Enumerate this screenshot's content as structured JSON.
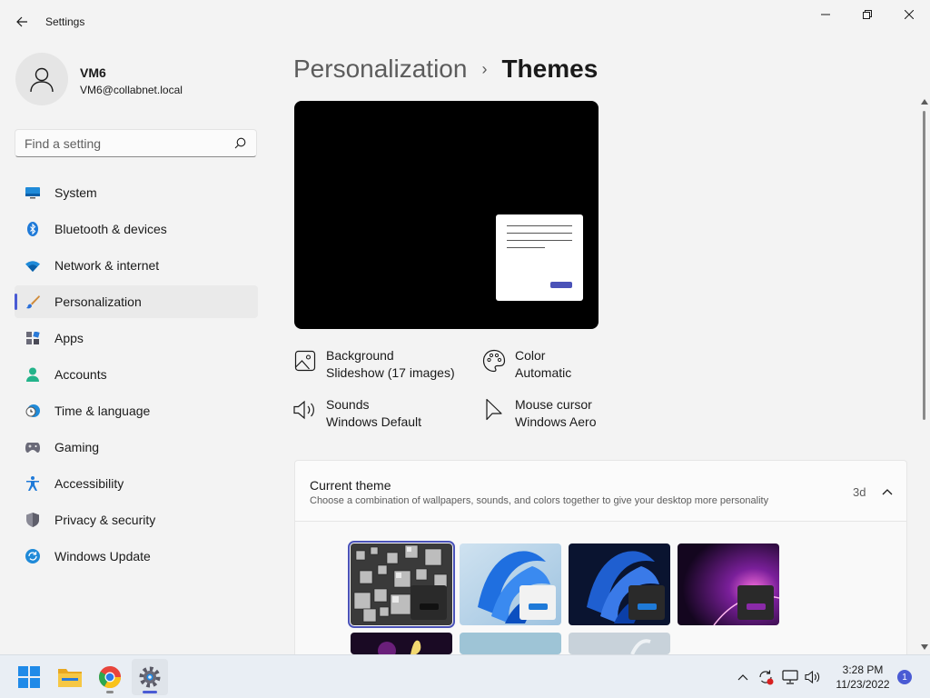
{
  "window": {
    "title": "Settings"
  },
  "profile": {
    "name": "VM6",
    "email": "VM6@collabnet.local"
  },
  "search": {
    "placeholder": "Find a setting"
  },
  "nav": {
    "items": [
      {
        "label": "System",
        "icon": "monitor-icon"
      },
      {
        "label": "Bluetooth & devices",
        "icon": "bluetooth-icon"
      },
      {
        "label": "Network & internet",
        "icon": "wifi-icon"
      },
      {
        "label": "Personalization",
        "icon": "brush-icon",
        "active": true
      },
      {
        "label": "Apps",
        "icon": "apps-icon"
      },
      {
        "label": "Accounts",
        "icon": "person-icon"
      },
      {
        "label": "Time & language",
        "icon": "clock-globe-icon"
      },
      {
        "label": "Gaming",
        "icon": "gamepad-icon"
      },
      {
        "label": "Accessibility",
        "icon": "accessibility-icon"
      },
      {
        "label": "Privacy & security",
        "icon": "shield-icon"
      },
      {
        "label": "Windows Update",
        "icon": "update-icon"
      }
    ]
  },
  "breadcrumb": {
    "parent": "Personalization",
    "separator": "›",
    "current": "Themes"
  },
  "properties": {
    "background": {
      "title": "Background",
      "value": "Slideshow (17 images)",
      "icon": "image-icon"
    },
    "color": {
      "title": "Color",
      "value": "Automatic",
      "icon": "palette-icon"
    },
    "sounds": {
      "title": "Sounds",
      "value": "Windows Default",
      "icon": "speaker-icon"
    },
    "cursor": {
      "title": "Mouse cursor",
      "value": "Windows Aero",
      "icon": "cursor-icon"
    }
  },
  "current_theme": {
    "title": "Current theme",
    "description": "Choose a combination of wallpapers, sounds, and colors together to give your desktop more personality",
    "value": "3d",
    "themes": [
      "3d-cubes",
      "windows-light",
      "windows-dark",
      "glow"
    ]
  },
  "taskbar": {
    "apps": [
      "start-icon",
      "file-explorer-icon",
      "chrome-icon",
      "settings-icon"
    ],
    "clock": {
      "time": "3:28 PM",
      "date": "11/23/2022"
    },
    "notification_count": "1"
  },
  "colors": {
    "accent": "#4a5bd4",
    "background": "#f3f3f3"
  }
}
